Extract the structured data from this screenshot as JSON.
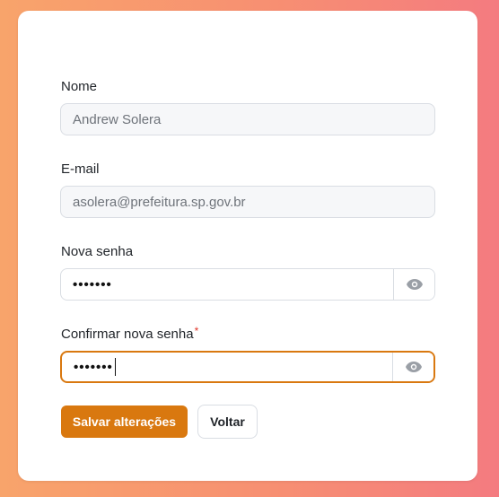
{
  "form": {
    "name_label": "Nome",
    "name_value": "Andrew Solera",
    "email_label": "E-mail",
    "email_value": "asolera@prefeitura.sp.gov.br",
    "new_password_label": "Nova senha",
    "new_password_masked": "•••••••",
    "confirm_password_label": "Confirmar nova senha",
    "required_marker": "*",
    "confirm_password_masked": "•••••••"
  },
  "actions": {
    "save_label": "Salvar alterações",
    "back_label": "Voltar"
  },
  "icons": {
    "toggle_visibility": "eye-icon"
  },
  "colors": {
    "accent": "#d9780f",
    "background_gradient_start": "#f8a46b",
    "background_gradient_end": "#f47b80"
  }
}
